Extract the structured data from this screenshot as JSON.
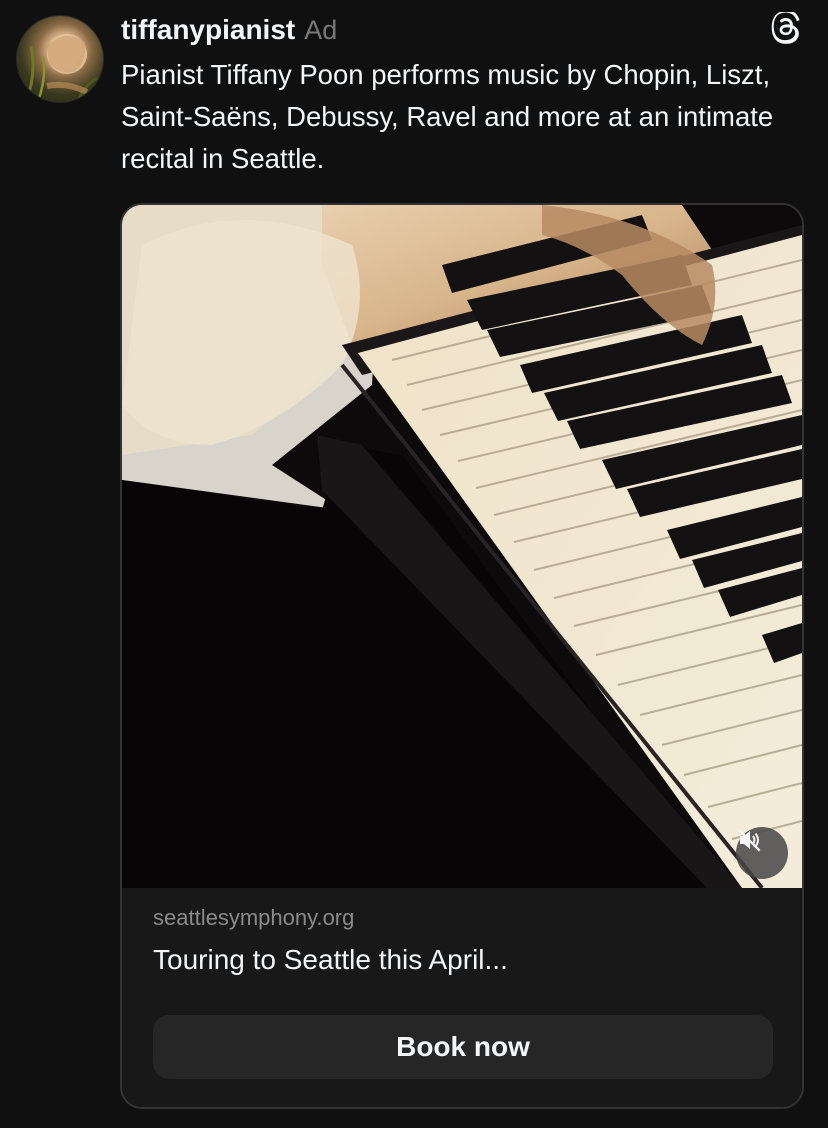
{
  "post": {
    "username": "tiffanypianist",
    "ad_label": "Ad",
    "caption": "Pianist Tiffany Poon performs music by Chopin, Liszt, Saint-Saëns, Debussy, Ravel and more at an intimate recital in Seattle.",
    "avatar_icon": "profile-photo",
    "logo_icon": "threads-logo-icon"
  },
  "media": {
    "description_icon": "piano-video",
    "sound_state_icon": "speaker-muted-icon"
  },
  "link_card": {
    "domain": "seattlesymphony.org",
    "headline": "Touring to Seattle this April...",
    "cta_label": "Book now"
  },
  "colors": {
    "background": "#101010",
    "text_primary": "#f3f5f7",
    "text_secondary": "#777777",
    "card_border": "#333333",
    "button_bg": "#262626"
  }
}
